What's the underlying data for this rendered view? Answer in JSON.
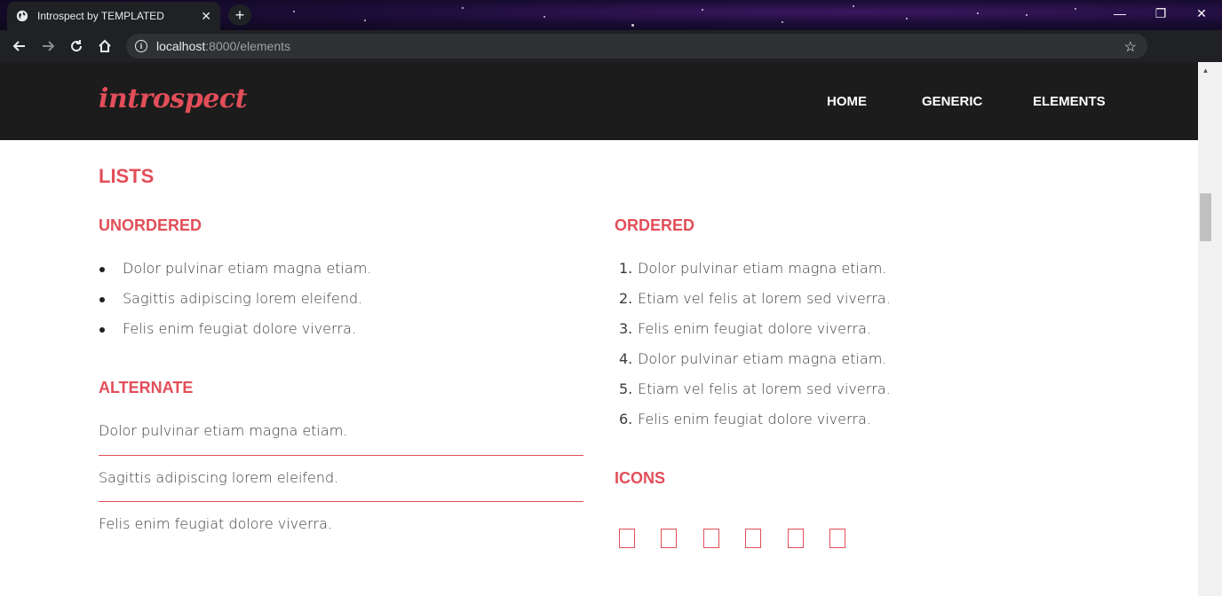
{
  "browser": {
    "tab_title": "Introspect by TEMPLATED",
    "tab_close": "✕",
    "new_tab": "+",
    "url_host": "localhost",
    "url_path": ":8000/elements",
    "window_controls": [
      "—",
      "❐",
      "✕"
    ]
  },
  "site": {
    "logo": "introspect",
    "nav": [
      "HOME",
      "GENERIC",
      "ELEMENTS"
    ],
    "accent_color": "#e24e59"
  },
  "lists": {
    "title": "LISTS",
    "unordered": {
      "heading": "UNORDERED",
      "items": [
        "Dolor pulvinar etiam magna etiam.",
        "Sagittis adipiscing lorem eleifend.",
        "Felis enim feugiat dolore viverra."
      ]
    },
    "alternate": {
      "heading": "ALTERNATE",
      "items": [
        "Dolor pulvinar etiam magna etiam.",
        "Sagittis adipiscing lorem eleifend.",
        "Felis enim feugiat dolore viverra."
      ]
    },
    "ordered": {
      "heading": "ORDERED",
      "items": [
        {
          "n": "1.",
          "text": "Dolor pulvinar etiam magna etiam."
        },
        {
          "n": "2.",
          "text": "Etiam vel felis at lorem sed viverra."
        },
        {
          "n": "3.",
          "text": "Felis enim feugiat dolore viverra."
        },
        {
          "n": "4.",
          "text": "Dolor pulvinar etiam magna etiam."
        },
        {
          "n": "5.",
          "text": "Etiam vel felis at lorem sed viverra."
        },
        {
          "n": "6.",
          "text": "Felis enim feugiat dolore viverra."
        }
      ]
    },
    "icons": {
      "heading": "ICONS",
      "items": [
        "missing-glyph-icon",
        "missing-glyph-icon",
        "missing-glyph-icon",
        "missing-glyph-icon",
        "missing-glyph-icon",
        "missing-glyph-icon"
      ]
    }
  }
}
